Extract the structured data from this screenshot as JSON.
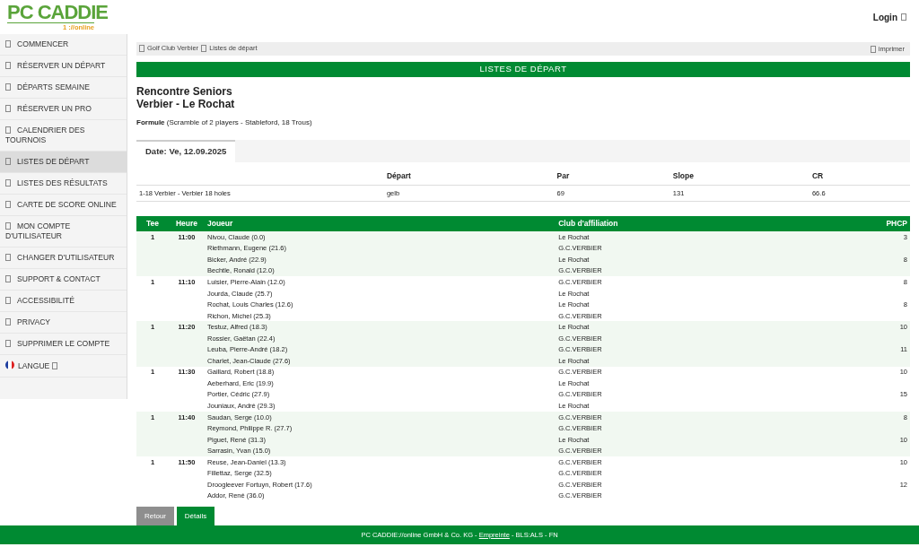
{
  "header": {
    "logo": "PC CADDIE",
    "logo_sub": "1 ://online",
    "login": "Login"
  },
  "sidebar": {
    "items": [
      {
        "label": "COMMENCER",
        "selected": false,
        "kind": "link"
      },
      {
        "label": "RÉSERVER UN DÉPART",
        "selected": false,
        "kind": "link"
      },
      {
        "label": "DÉPARTS SEMAINE",
        "selected": false,
        "kind": "link"
      },
      {
        "label": "RÉSERVER UN PRO",
        "selected": false,
        "kind": "link"
      },
      {
        "label": "CALENDRIER DES TOURNOIS",
        "selected": false,
        "kind": "link"
      },
      {
        "label": "LISTES DE DÉPART",
        "selected": true,
        "kind": "link"
      },
      {
        "label": "LISTES DES RÉSULTATS",
        "selected": false,
        "kind": "link"
      },
      {
        "label": "CARTE DE SCORE ONLINE",
        "selected": false,
        "kind": "link"
      },
      {
        "label": "MON COMPTE D'UTILISATEUR",
        "selected": false,
        "kind": "link"
      },
      {
        "label": "CHANGER D'UTILISATEUR",
        "selected": false,
        "kind": "link"
      },
      {
        "label": "SUPPORT & CONTACT",
        "selected": false,
        "kind": "link"
      },
      {
        "label": "ACCESSIBILITÉ",
        "selected": false,
        "kind": "link"
      },
      {
        "label": "PRIVACY",
        "selected": false,
        "kind": "link"
      },
      {
        "label": "SUPPRIMER LE COMPTE",
        "selected": false,
        "kind": "link"
      },
      {
        "label": "LANGUE",
        "selected": false,
        "kind": "language"
      }
    ]
  },
  "breadcrumb": {
    "items": [
      "Golf Club Verbier",
      "Listes de départ"
    ],
    "print": "imprimer"
  },
  "banner": "LISTES DE DÉPART",
  "title_lines": [
    "Rencontre Seniors",
    "Verbier - Le Rochat"
  ],
  "formula": "**Formule** (Scramble of 2 players - Stableford, 18 Trous)",
  "tabs": [
    {
      "label": "Date: Ve, 12.09.2025",
      "selected": true
    }
  ],
  "course_table": {
    "columns": [
      "",
      "Départ",
      "Par",
      "Slope",
      "CR"
    ],
    "rows": [
      [
        "1-18 Verbier - Verbier 18 holes",
        "gelb",
        "69",
        "131",
        "66.6"
      ]
    ]
  },
  "start_list": {
    "columns": [
      "Tee",
      "Heure",
      "Joueur",
      "Club d'affiliation",
      "PHCP"
    ],
    "flights": [
      {
        "tee": "1",
        "time": "11:00",
        "players": [
          {
            "name": "Nivou, Claude (0.0)",
            "club": "Le Rochat",
            "phcp": "3"
          },
          {
            "name": "Riethmann, Eugene (21.6)",
            "club": "G.C.VERBIER"
          },
          {
            "name": "Bicker, André (22.9)",
            "club": "Le Rochat",
            "phcp": "8"
          },
          {
            "name": "Bechtle, Ronald (12.0)",
            "club": "G.C.VERBIER"
          }
        ]
      },
      {
        "tee": "1",
        "time": "11:10",
        "players": [
          {
            "name": "Luisier, Pierre-Alain (12.0)",
            "club": "G.C.VERBIER",
            "phcp": "8"
          },
          {
            "name": "Jourda, Claude (25.7)",
            "club": "Le Rochat"
          },
          {
            "name": "Rochat, Louis Charles (12.6)",
            "club": "Le Rochat",
            "phcp": "8"
          },
          {
            "name": "Richon, Michel (25.3)",
            "club": "G.C.VERBIER"
          }
        ]
      },
      {
        "tee": "1",
        "time": "11:20",
        "players": [
          {
            "name": "Testuz, Alfred (18.3)",
            "club": "Le Rochat",
            "phcp": "10"
          },
          {
            "name": "Rossier, Gaëtan (22.4)",
            "club": "G.C.VERBIER"
          },
          {
            "name": "Leuba, Pierre-André (18.2)",
            "club": "G.C.VERBIER",
            "phcp": "11"
          },
          {
            "name": "Charlet, Jean-Claude (27.6)",
            "club": "Le Rochat"
          }
        ]
      },
      {
        "tee": "1",
        "time": "11:30",
        "players": [
          {
            "name": "Gaillard, Robert (18.8)",
            "club": "G.C.VERBIER",
            "phcp": "10"
          },
          {
            "name": "Aeberhard, Eric (19.9)",
            "club": "Le Rochat"
          },
          {
            "name": "Portier, Cédric (27.9)",
            "club": "G.C.VERBIER",
            "phcp": "15"
          },
          {
            "name": "Jouniaux, André (29.3)",
            "club": "Le Rochat"
          }
        ]
      },
      {
        "tee": "1",
        "time": "11:40",
        "players": [
          {
            "name": "Saudan, Serge (10.0)",
            "club": "G.C.VERBIER",
            "phcp": "8"
          },
          {
            "name": "Reymond, Philippe R. (27.7)",
            "club": "G.C.VERBIER"
          },
          {
            "name": "Piguet, René (31.3)",
            "club": "Le Rochat",
            "phcp": "10"
          },
          {
            "name": "Sarrasin, Yvan (15.0)",
            "club": "G.C.VERBIER"
          }
        ]
      },
      {
        "tee": "1",
        "time": "11:50",
        "players": [
          {
            "name": "Reuse, Jean-Daniel (13.3)",
            "club": "G.C.VERBIER",
            "phcp": "10"
          },
          {
            "name": "Fillettaz, Serge (32.5)",
            "club": "G.C.VERBIER"
          },
          {
            "name": "Droogleever Fortuyn, Robert (17.6)",
            "club": "G.C.VERBIER",
            "phcp": "12"
          },
          {
            "name": "Addor, René (36.0)",
            "club": "G.C.VERBIER"
          }
        ]
      }
    ]
  },
  "buttons": [
    {
      "label": "Retour",
      "kind": "secondary"
    },
    {
      "label": "Détails",
      "kind": "primary"
    }
  ],
  "footer": {
    "before": "PC CADDIE://online GmbH & Co. KG - ",
    "link": "Empreinte",
    "after": " - BLS:ALS - FN"
  }
}
